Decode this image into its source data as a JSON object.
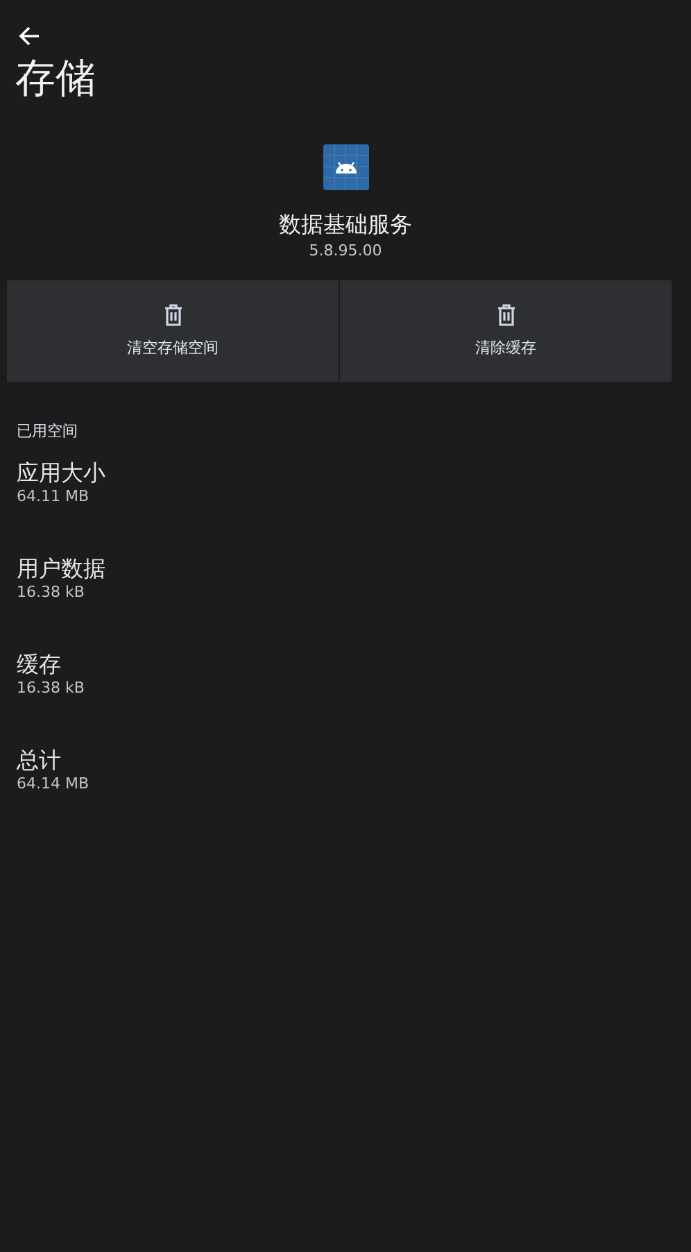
{
  "header": {
    "title": "存储"
  },
  "app": {
    "name": "数据基础服务",
    "version": "5.8.95.00"
  },
  "actions": [
    {
      "label": "清空存储空间"
    },
    {
      "label": "清除缓存"
    }
  ],
  "section": {
    "title": "已用空间"
  },
  "items": [
    {
      "title": "应用大小",
      "value": "64.11 MB"
    },
    {
      "title": "用户数据",
      "value": "16.38 kB"
    },
    {
      "title": "缓存",
      "value": "16.38 kB"
    },
    {
      "title": "总计",
      "value": "64.14 MB"
    }
  ]
}
